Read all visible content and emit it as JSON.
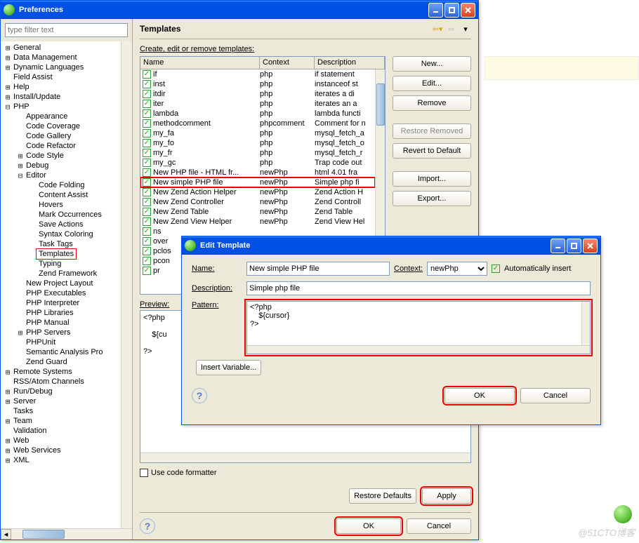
{
  "prefs": {
    "title": "Preferences",
    "filter_placeholder": "type filter text",
    "tree": [
      {
        "t": "+",
        "l": "General",
        "d": 0
      },
      {
        "t": "+",
        "l": "Data Management",
        "d": 0
      },
      {
        "t": "+",
        "l": "Dynamic Languages",
        "d": 0
      },
      {
        "t": " ",
        "l": "Field Assist",
        "d": 0
      },
      {
        "t": "+",
        "l": "Help",
        "d": 0
      },
      {
        "t": "+",
        "l": "Install/Update",
        "d": 0
      },
      {
        "t": "-",
        "l": "PHP",
        "d": 0
      },
      {
        "t": " ",
        "l": "Appearance",
        "d": 1
      },
      {
        "t": " ",
        "l": "Code Coverage",
        "d": 1
      },
      {
        "t": " ",
        "l": "Code Gallery",
        "d": 1
      },
      {
        "t": " ",
        "l": "Code Refactor",
        "d": 1
      },
      {
        "t": "+",
        "l": "Code Style",
        "d": 1
      },
      {
        "t": "+",
        "l": "Debug",
        "d": 1
      },
      {
        "t": "-",
        "l": "Editor",
        "d": 1
      },
      {
        "t": " ",
        "l": "Code Folding",
        "d": 2
      },
      {
        "t": " ",
        "l": "Content Assist",
        "d": 2
      },
      {
        "t": " ",
        "l": "Hovers",
        "d": 2
      },
      {
        "t": " ",
        "l": "Mark Occurrences",
        "d": 2
      },
      {
        "t": " ",
        "l": "Save Actions",
        "d": 2
      },
      {
        "t": " ",
        "l": "Syntax Coloring",
        "d": 2
      },
      {
        "t": " ",
        "l": "Task Tags",
        "d": 2
      },
      {
        "t": " ",
        "l": "Templates",
        "d": 2,
        "sel": true
      },
      {
        "t": " ",
        "l": "Typing",
        "d": 2
      },
      {
        "t": " ",
        "l": "Zend Framework",
        "d": 2
      },
      {
        "t": " ",
        "l": "New Project Layout",
        "d": 1
      },
      {
        "t": " ",
        "l": "PHP Executables",
        "d": 1
      },
      {
        "t": " ",
        "l": "PHP Interpreter",
        "d": 1
      },
      {
        "t": " ",
        "l": "PHP Libraries",
        "d": 1
      },
      {
        "t": " ",
        "l": "PHP Manual",
        "d": 1
      },
      {
        "t": "+",
        "l": "PHP Servers",
        "d": 1
      },
      {
        "t": " ",
        "l": "PHPUnit",
        "d": 1
      },
      {
        "t": " ",
        "l": "Semantic Analysis Pro",
        "d": 1
      },
      {
        "t": " ",
        "l": "Zend Guard",
        "d": 1
      },
      {
        "t": "+",
        "l": "Remote Systems",
        "d": 0
      },
      {
        "t": " ",
        "l": "RSS/Atom Channels",
        "d": 0
      },
      {
        "t": "+",
        "l": "Run/Debug",
        "d": 0
      },
      {
        "t": "+",
        "l": "Server",
        "d": 0
      },
      {
        "t": " ",
        "l": "Tasks",
        "d": 0
      },
      {
        "t": "+",
        "l": "Team",
        "d": 0
      },
      {
        "t": " ",
        "l": "Validation",
        "d": 0
      },
      {
        "t": "+",
        "l": "Web",
        "d": 0
      },
      {
        "t": "+",
        "l": "Web Services",
        "d": 0
      },
      {
        "t": "+",
        "l": "XML",
        "d": 0
      }
    ],
    "page_title": "Templates",
    "instruction": "Create, edit or remove templates:",
    "columns": {
      "name": "Name",
      "context": "Context",
      "description": "Description"
    },
    "rows": [
      {
        "n": "if",
        "c": "php",
        "d": "if statement"
      },
      {
        "n": "inst",
        "c": "php",
        "d": "instanceof st"
      },
      {
        "n": "itdir",
        "c": "php",
        "d": "iterates a di"
      },
      {
        "n": "iter",
        "c": "php",
        "d": "iterates an a"
      },
      {
        "n": "lambda",
        "c": "php",
        "d": "lambda functi"
      },
      {
        "n": "methodcomment",
        "c": "phpcomment",
        "d": "Comment for n"
      },
      {
        "n": "my_fa",
        "c": "php",
        "d": "mysql_fetch_a"
      },
      {
        "n": "my_fo",
        "c": "php",
        "d": "mysql_fetch_o"
      },
      {
        "n": "my_fr",
        "c": "php",
        "d": "mysql_fetch_r"
      },
      {
        "n": "my_gc",
        "c": "php",
        "d": "Trap code out"
      },
      {
        "n": "New PHP file - HTML fr...",
        "c": "newPhp",
        "d": "html 4.01 fra"
      },
      {
        "n": "New simple PHP file",
        "c": "newPhp",
        "d": "Simple php fi",
        "sel": true
      },
      {
        "n": "New Zend Action Helper",
        "c": "newPhp",
        "d": "Zend Action H"
      },
      {
        "n": "New Zend Controller",
        "c": "newPhp",
        "d": "Zend Controll"
      },
      {
        "n": "New Zend Table",
        "c": "newPhp",
        "d": "Zend Table"
      },
      {
        "n": "New Zend View Helper",
        "c": "newPhp",
        "d": "Zend View Hel"
      },
      {
        "n": "ns",
        "c": "",
        "d": ""
      },
      {
        "n": "over",
        "c": "",
        "d": ""
      },
      {
        "n": "pclos",
        "c": "",
        "d": ""
      },
      {
        "n": "pcon",
        "c": "",
        "d": ""
      },
      {
        "n": "pr",
        "c": "",
        "d": ""
      }
    ],
    "buttons": {
      "new": "New...",
      "edit": "Edit...",
      "remove": "Remove",
      "restore_removed": "Restore Removed",
      "revert": "Revert to Default",
      "import": "Import...",
      "export": "Export..."
    },
    "preview_label": "Preview:",
    "preview_text": "<?php\n\n    ${cu\n\n?>",
    "use_fmt": "Use code formatter",
    "restore_defaults": "Restore Defaults",
    "apply": "Apply",
    "ok": "OK",
    "cancel": "Cancel"
  },
  "dlg": {
    "title": "Edit Template",
    "name_label": "Name:",
    "name": "New simple PHP file",
    "context_label": "Context:",
    "context": "newPhp",
    "auto_insert": "Automatically insert",
    "desc_label": "Description:",
    "desc": "Simple php file",
    "pattern_label": "Pattern:",
    "pattern": "<?php\n    ${cursor}\n?>",
    "insert_var": "Insert Variable...",
    "ok": "OK",
    "cancel": "Cancel"
  },
  "watermark": "@51CTO博客"
}
